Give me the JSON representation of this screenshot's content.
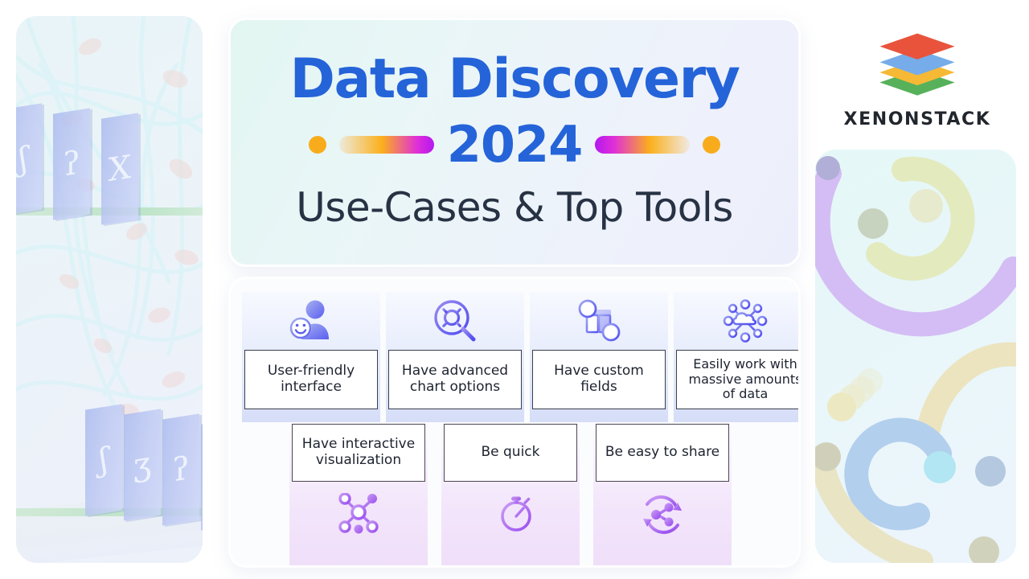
{
  "brand": {
    "name": "XENONSTACK",
    "logo_icon": "stacked-layers-logo-icon",
    "layer_colors": [
      "#e8452c",
      "#6aa6e8",
      "#f6b426",
      "#4caf50"
    ]
  },
  "hero": {
    "title": "Data Discovery",
    "year": "2024",
    "subtitle": "Use-Cases & Top Tools",
    "title_color": "#2563d9",
    "subtitle_color": "#273244",
    "divider_dot_color": "#f9ac1b",
    "divider_gradient": [
      "#fbb01c",
      "#e02fd8",
      "#b517f0"
    ]
  },
  "features": {
    "row_top": [
      {
        "label": "User-friendly interface",
        "icon": "user-smile-icon"
      },
      {
        "label": "Have advanced chart options",
        "icon": "magnifier-gear-icon"
      },
      {
        "label": "Have custom fields",
        "icon": "custom-fields-plus-minus-icon"
      },
      {
        "label": "Easily work with massive amounts of data",
        "icon": "cloud-network-nodes-icon"
      }
    ],
    "row_bottom": [
      {
        "label": "Have interactive visualization",
        "icon": "node-graph-icon"
      },
      {
        "label": "Be quick",
        "icon": "fast-stopwatch-icon"
      },
      {
        "label": "Be easy to share",
        "icon": "share-refresh-icon"
      }
    ]
  },
  "decor": {
    "left_image": "abstract-data-slabs-fiber-network-image",
    "right_image": "abstract-pastel-spirals-image"
  }
}
